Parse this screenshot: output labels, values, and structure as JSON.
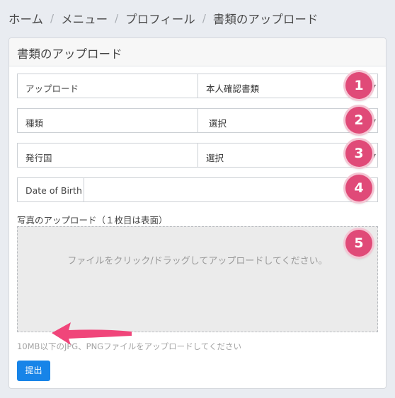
{
  "breadcrumb": {
    "items": [
      "ホーム",
      "メニュー",
      "プロフィール",
      "書類のアップロード"
    ],
    "separator": "/"
  },
  "card": {
    "title": "書類のアップロード"
  },
  "form": {
    "upload_type": {
      "label": "アップロード",
      "value": "本人確認書類",
      "caret": "▼"
    },
    "doc_type": {
      "label": "種類",
      "value": "選択",
      "caret": "▼"
    },
    "country": {
      "label": "発行国",
      "value": "選択",
      "caret": "▼"
    },
    "dob": {
      "label": "Date of Birth",
      "value": ""
    },
    "photo_label": "写真のアップロード（１枚目は表面）",
    "dropzone_text": "ファイルをクリック/ドラッグしてアップロードしてください。",
    "hint": "10MB以下のJPG、PNGファイルをアップロードしてください",
    "submit_label": "提出"
  },
  "annotations": {
    "badges": [
      "1",
      "2",
      "3",
      "4",
      "5"
    ],
    "badge_color": "#e04a78",
    "arrow_color": "#f0457a"
  },
  "colors": {
    "accent": "#1784e8",
    "page_bg": "#e9ecf1",
    "dropzone_bg": "#ebebeb"
  }
}
